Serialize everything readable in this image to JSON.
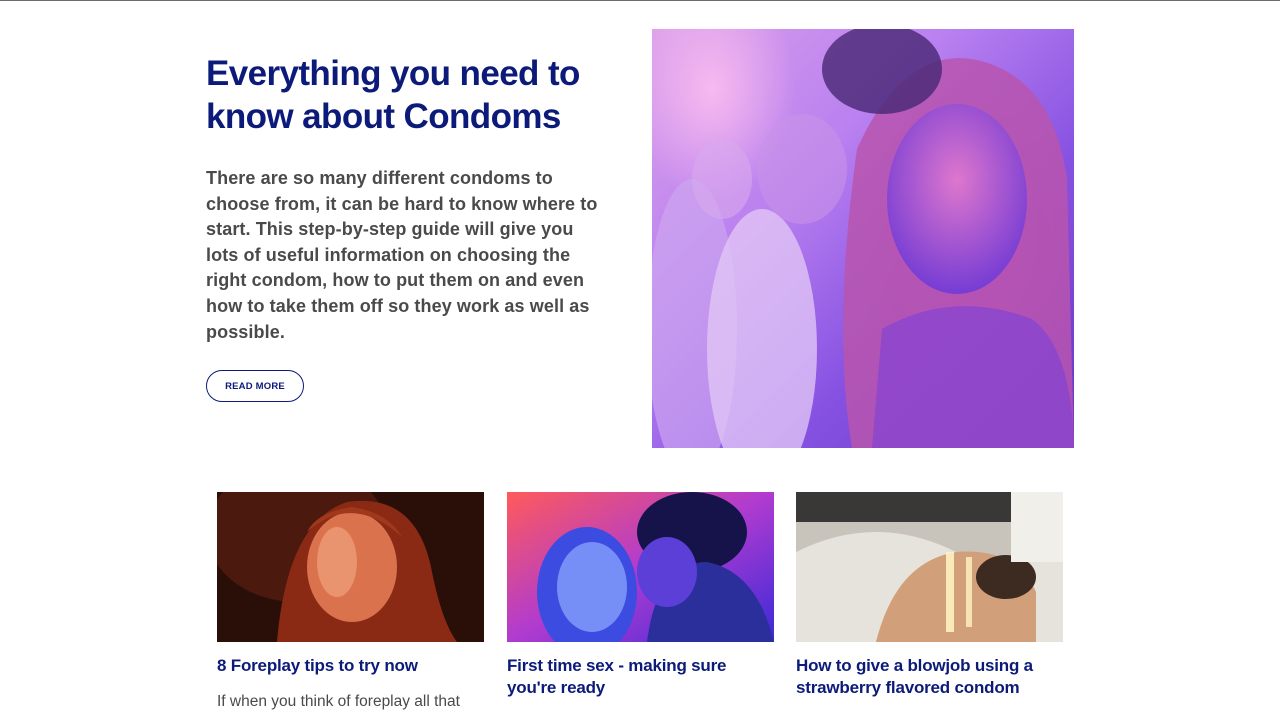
{
  "hero": {
    "title": "Everything you need to know about Condoms",
    "body": "There are so many different condoms to choose from, it can be hard to know where to start. This step-by-step guide will give you lots of useful information on choosing the right condom, how to put them on and even how to take them off so they work as well as possible.",
    "cta_label": "READ MORE",
    "image_icon": "photo-party-portrait"
  },
  "cards": [
    {
      "title": "8 Foreplay tips to try now",
      "excerpt": "If when you think of foreplay all that",
      "image_icon": "photo-woman-portrait"
    },
    {
      "title": "First time sex - making sure you're ready",
      "excerpt": "",
      "image_icon": "photo-couple-party"
    },
    {
      "title": "How to give a blowjob using a strawberry flavored condom",
      "excerpt": "",
      "image_icon": "photo-bedroom"
    }
  ],
  "colors": {
    "brand": "#0c1b79",
    "body_text": "#4a4a4a"
  }
}
